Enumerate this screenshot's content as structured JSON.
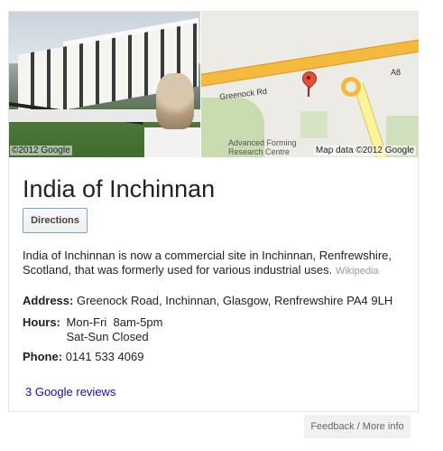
{
  "place": {
    "title": "India of Inchinnan",
    "directions_label": "Directions",
    "description": "India of Inchinnan is now a commercial site in Inchinnan, Renfrewshire, Scotland, that was formerly used for various industrial uses.",
    "description_source": "Wikipedia",
    "address_label": "Address:",
    "address_value": "Greenock Road, Inchinnan, Glasgow, Renfrewshire PA4 9LH",
    "hours_label": "Hours:",
    "hours": [
      "Mon-Fri  8am-5pm",
      "Sat-Sun Closed"
    ],
    "phone_label": "Phone:",
    "phone_value": "0141 533 4069",
    "reviews_label": "3 Google reviews"
  },
  "map": {
    "road_label": "Greenock Rd",
    "road_number": "A8",
    "place_label_line1": "Advanced Forming",
    "place_label_line2": "Research Centre",
    "attribution_left": "©2012 Google",
    "attribution_right": "Map data ©2012 Google"
  },
  "footer": {
    "feedback_label": "Feedback / More info"
  }
}
